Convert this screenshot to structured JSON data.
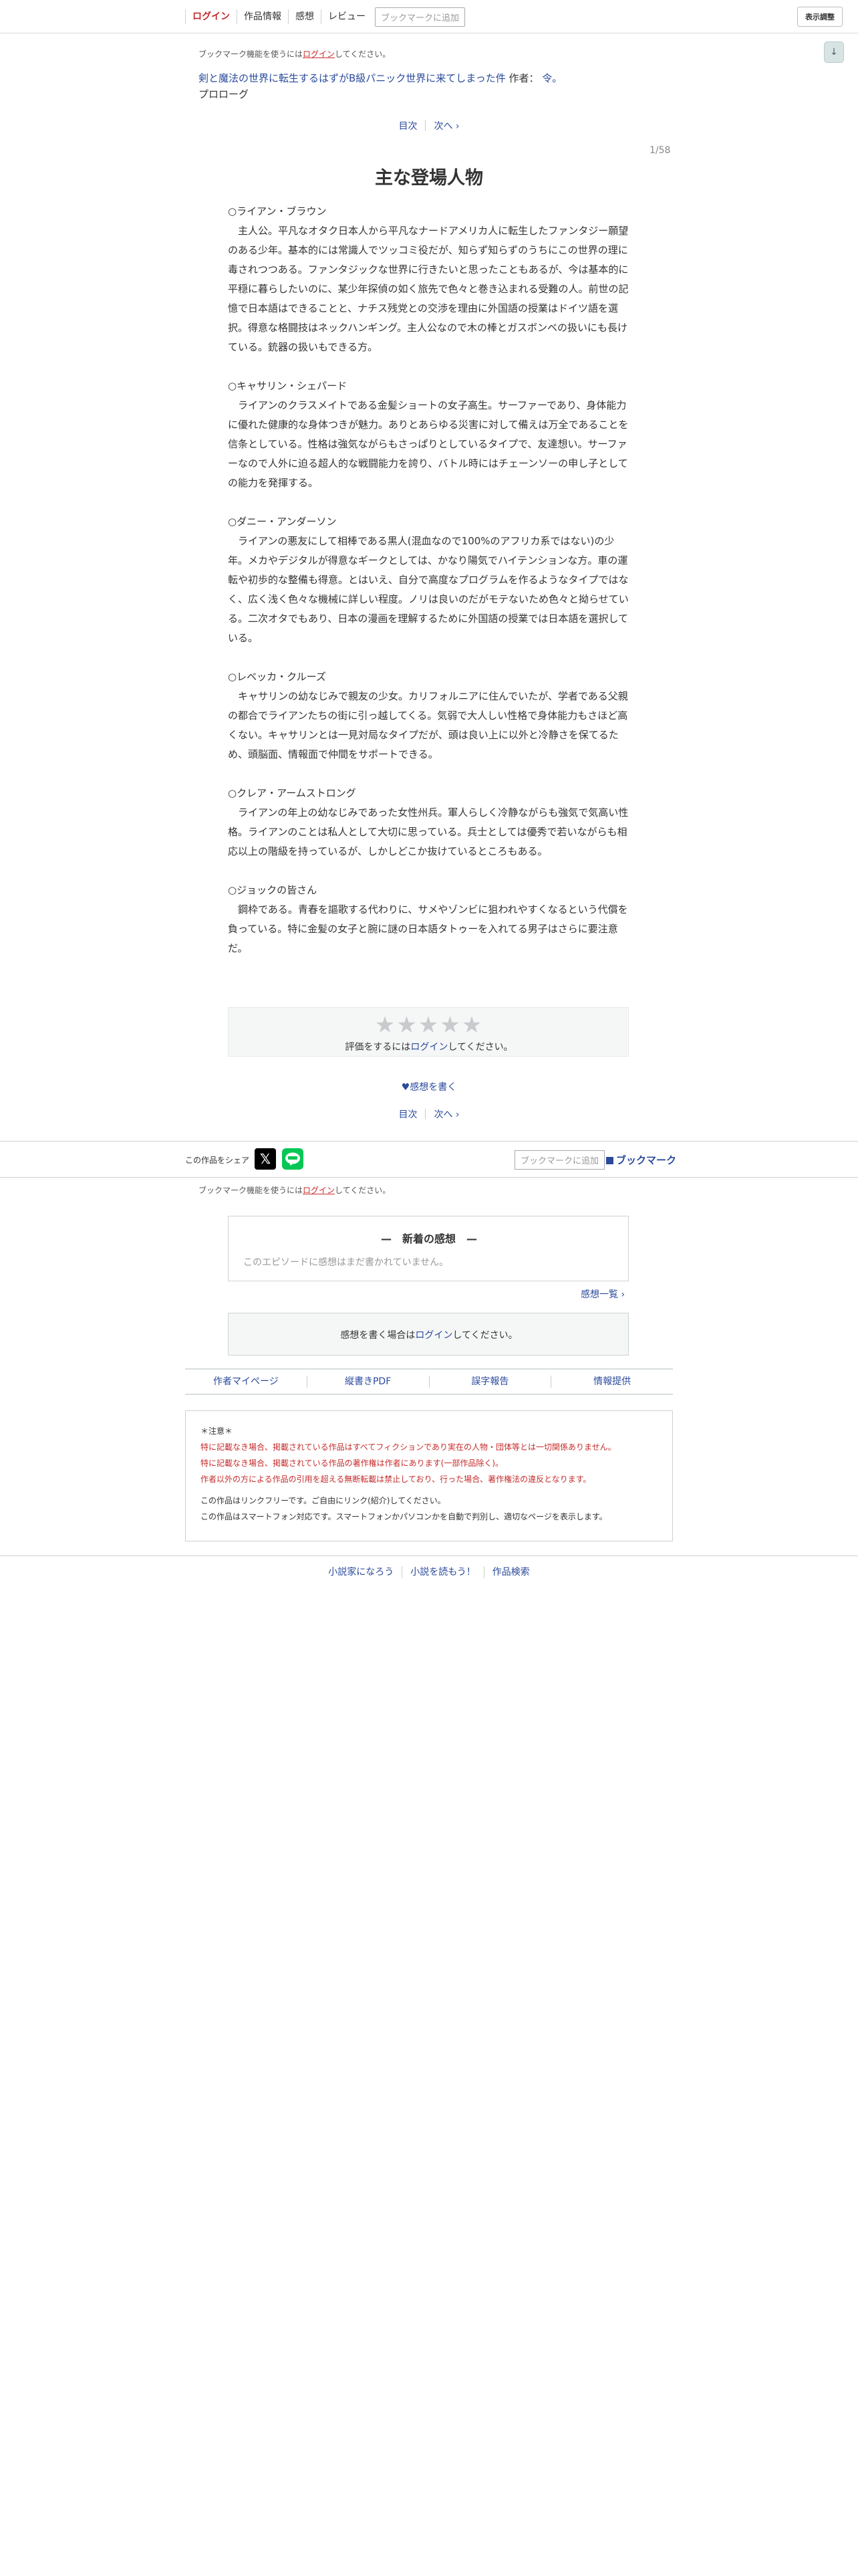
{
  "header": {
    "nav": [
      "ログイン",
      "作品情報",
      "感想",
      "レビュー"
    ],
    "bookmark_add": "ブックマークに追加",
    "display_settings": "表示調整",
    "scroll_arrow": "↓"
  },
  "bookmark_notice": {
    "prefix": "ブックマーク機能を使うには",
    "login": "ログイン",
    "suffix": "してください。"
  },
  "novel": {
    "title": "剣と魔法の世界に転生するはずがB級パニック世界に来てしまった件",
    "author_label": "作者：",
    "author": "令。",
    "subtitle": "プロローグ"
  },
  "pager": {
    "toc": "目次",
    "next": "次へ ›"
  },
  "page_count": "1/58",
  "chapter_title": "主な登場人物",
  "characters": [
    {
      "heading": "○ライアン・ブラウン",
      "text": "主人公。平凡なオタク日本人から平凡なナードアメリカ人に転生したファンタジー願望のある少年。基本的には常識人でツッコミ役だが、知らず知らずのうちにこの世界の理に毒されつつある。ファンタジックな世界に行きたいと思ったこともあるが、今は基本的に平穏に暮らしたいのに、某少年探偵の如く旅先で色々と巻き込まれる受難の人。前世の記憶で日本語はできることと、ナチス残党との交渉を理由に外国語の授業はドイツ語を選択。得意な格闘技はネックハンギング。主人公なので木の棒とガスボンベの扱いにも長けている。銃器の扱いもできる方。"
    },
    {
      "heading": "○キャサリン・シェパード",
      "text": "ライアンのクラスメイトである金髪ショートの女子高生。サーファーであり、身体能力に優れた健康的な身体つきが魅力。ありとあらゆる災害に対して備えは万全であることを信条としている。性格は強気ながらもさっぱりとしているタイプで、友達想い。サーファーなので人外に迫る超人的な戦闘能力を誇り、バトル時にはチェーンソーの申し子としての能力を発揮する。"
    },
    {
      "heading": "○ダニー・アンダーソン",
      "text": "ライアンの悪友にして相棒である黒人(混血なので100%のアフリカ系ではない)の少年。メカやデジタルが得意なギークとしては、かなり陽気でハイテンションな方。車の運転や初歩的な整備も得意。とはいえ、自分で高度なプログラムを作るようなタイプではなく、広く浅く色々な機械に詳しい程度。ノリは良いのだがモテないため色々と拗らせている。二次オタでもあり、日本の漫画を理解するために外国語の授業では日本語を選択している。"
    },
    {
      "heading": "○レベッカ・クルーズ",
      "text": "キャサリンの幼なじみで親友の少女。カリフォルニアに住んでいたが、学者である父親の都合でライアンたちの街に引っ越してくる。気弱で大人しい性格で身体能力もさほど高くない。キャサリンとは一見対局なタイプだが、頭は良い上に以外と冷静さを保てるため、頭脳面、情報面で仲間をサポートできる。"
    },
    {
      "heading": "○クレア・アームストロング",
      "text": "ライアンの年上の幼なじみであった女性州兵。軍人らしく冷静ながらも強気で気高い性格。ライアンのことは私人として大切に思っている。兵士としては優秀で若いながらも相応以上の階級を持っているが、しかしどこか抜けているところもある。"
    },
    {
      "heading": "○ジョックの皆さん",
      "text": "鋼枠である。青春を謳歌する代わりに、サメやゾンビに狙われやすくなるという代償を負っている。特に金髪の女子と腕に謎の日本語タトゥーを入れてる男子はさらに要注意だ。"
    }
  ],
  "rating": {
    "stars": "★★★★★",
    "note_prefix": "評価をするには",
    "login": "ログイン",
    "note_suffix": "してください。"
  },
  "write_review": "♥感想を書く",
  "share": {
    "label": "この作品をシェア",
    "x_glyph": "𝕏",
    "bookmark_add": "ブックマークに追加",
    "bookmark": "ブックマーク"
  },
  "impressions": {
    "title": "—　新着の感想　—",
    "empty": "このエピソードに感想はまだ書かれていません。",
    "list_link": "感想一覧 ›"
  },
  "write_notice": {
    "prefix": "感想を書く場合は",
    "login": "ログイン",
    "suffix": "してください。"
  },
  "footer_links": [
    "作者マイページ",
    "縦書きPDF",
    "誤字報告",
    "情報提供"
  ],
  "notice": {
    "heading": "＊注意＊",
    "red_lines": [
      "特に記載なき場合、掲載されている作品はすべてフィクションであり実在の人物・団体等とは一切関係ありません。",
      "特に記載なき場合、掲載されている作品の著作権は作者にあります(一部作品除く)。",
      "作者以外の方による作品の引用を超える無断転載は禁止しており、行った場合、著作権法の違反となります。"
    ],
    "gray_lines": [
      "この作品はリンクフリーです。ご自由にリンク(紹介)してください。",
      "この作品はスマートフォン対応です。スマートフォンかパソコンかを自動で判別し、適切なページを表示します。"
    ]
  },
  "bottom_links": [
    "小説家になろう",
    "小説を読もう！",
    "作品検索"
  ]
}
